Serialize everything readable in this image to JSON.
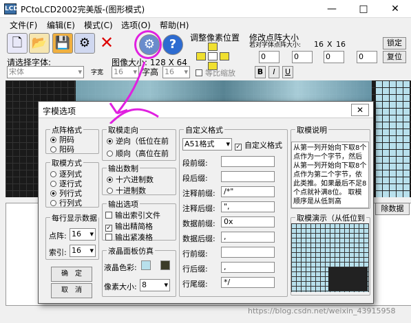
{
  "window": {
    "title": "PCtoLCD2002完美版-(图形模式)",
    "app_icon": "LCD",
    "minimize": "—",
    "maximize": "□",
    "close": "✕"
  },
  "menu": [
    "文件(F)",
    "编辑(E)",
    "模式(C)",
    "选项(O)",
    "帮助(H)"
  ],
  "toolbar": {
    "pixel_adjust": "调整像素位置",
    "resize": "修改点阵大小",
    "resize_hint": "若对字体点阵大小:",
    "size_a": "16",
    "size_x": "X",
    "size_b": "16",
    "lock": "锁定",
    "reset": "复位",
    "font_prompt": "请选择字体:",
    "font": "宋体",
    "width_lbl": "字宽",
    "width_val": "16",
    "img_size": "图像大小: 128 X 64",
    "height_lbl": "字高",
    "height_val": "16",
    "ratio": "等比缩放",
    "bold": "B",
    "italic": "I",
    "underline": "U",
    "spin_values": [
      "0",
      "0",
      "0",
      "0"
    ],
    "clear_btn": "除数据"
  },
  "dialog": {
    "title": "字模选项",
    "close": "✕",
    "dot_format": {
      "title": "点阵格式",
      "opts": [
        "阴码",
        "阳码"
      ],
      "selected": 0
    },
    "mode": {
      "title": "取模方式",
      "opts": [
        "逐列式",
        "逐行式",
        "列行式",
        "行列式"
      ],
      "selected": 2
    },
    "per_line": {
      "title": "每行显示数据",
      "dot_lbl": "点阵:",
      "dot_val": "16",
      "idx_lbl": "索引:",
      "idx_val": "16"
    },
    "ok": "确　定",
    "cancel": "取　消",
    "direction": {
      "title": "取模走向",
      "opts": [
        "逆向（低位在前",
        "顺向（高位在前"
      ],
      "selected": 0
    },
    "base": {
      "title": "输出数制",
      "opts": [
        "十六进制数",
        "十进制数"
      ],
      "selected": 0
    },
    "output": {
      "title": "输出选项",
      "opts": [
        {
          "label": "输出索引文件",
          "checked": false
        },
        {
          "label": "输出精简格",
          "checked": true
        },
        {
          "label": "输出紧凑格",
          "checked": false
        }
      ]
    },
    "lcd": {
      "title": "液晶面板仿真",
      "color_lbl": "液晶色彩:",
      "pixel_lbl": "像素大小:",
      "pixel_val": "8",
      "colors": [
        "#b8e0ec",
        "#3a3a28"
      ]
    },
    "custom": {
      "title": "自定义格式",
      "format": "A51格式",
      "custom_chk": "自定义格式",
      "rows": [
        {
          "label": "段前缀:",
          "value": ""
        },
        {
          "label": "段后缀:",
          "value": ""
        },
        {
          "label": "注释前缀:",
          "value": "/*\""
        },
        {
          "label": "注释后缀:",
          "value": "\","
        },
        {
          "label": "数据前缀:",
          "value": "0x"
        },
        {
          "label": "数据后缀:",
          "value": ","
        },
        {
          "label": "行前缀:",
          "value": ""
        },
        {
          "label": "行后缀:",
          "value": ","
        },
        {
          "label": "行尾缀:",
          "value": "*/"
        }
      ]
    },
    "desc": {
      "title": "取模说明",
      "text": "从第一列开始向下取8个点作为一个字节，然后从第一列开始向下取8个点作为第二个字节，依此类推。如果最后不足8个点就补满8位。 取模顺序是从低到高"
    },
    "preview_title": "取模演示（从低位到"
  },
  "watermark": "https://blog.csdn.net/weixin_43915958"
}
